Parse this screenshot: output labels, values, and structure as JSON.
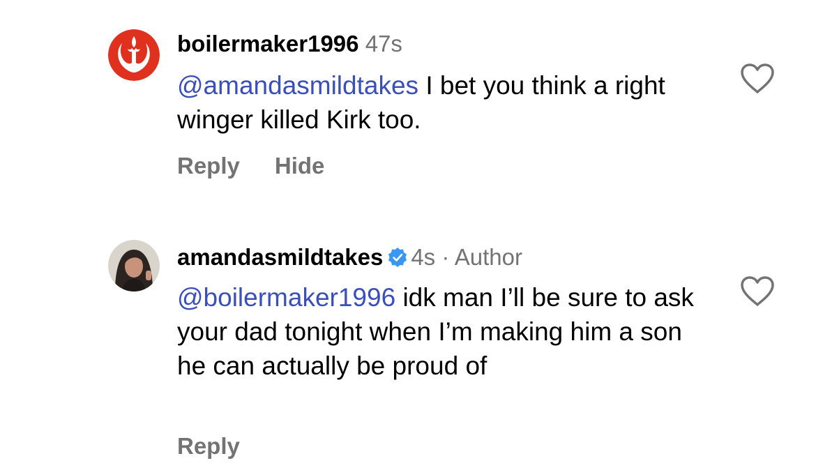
{
  "comments": [
    {
      "username": "boilermaker1996",
      "time": "47s",
      "mention": "@amandasmildtakes",
      "text": " I bet you think a right winger killed Kirk too.",
      "actions": [
        "Reply",
        "Hide"
      ],
      "avatar_icon": "rebel-alliance-icon",
      "avatar_color": "#e0301e"
    },
    {
      "username": "amandasmildtakes",
      "verified": true,
      "time": "4s",
      "separator": "·",
      "role": "Author",
      "mention": "@boilermaker1996",
      "text": " idk man I’ll be sure to ask your dad tonight when I’m making him a son he can actually be proud of",
      "actions": [
        "Reply"
      ],
      "avatar_icon": "profile-photo",
      "verified_color": "#3897f0"
    }
  ],
  "colors": {
    "mention": "#3b4fb8",
    "muted": "#737373"
  }
}
